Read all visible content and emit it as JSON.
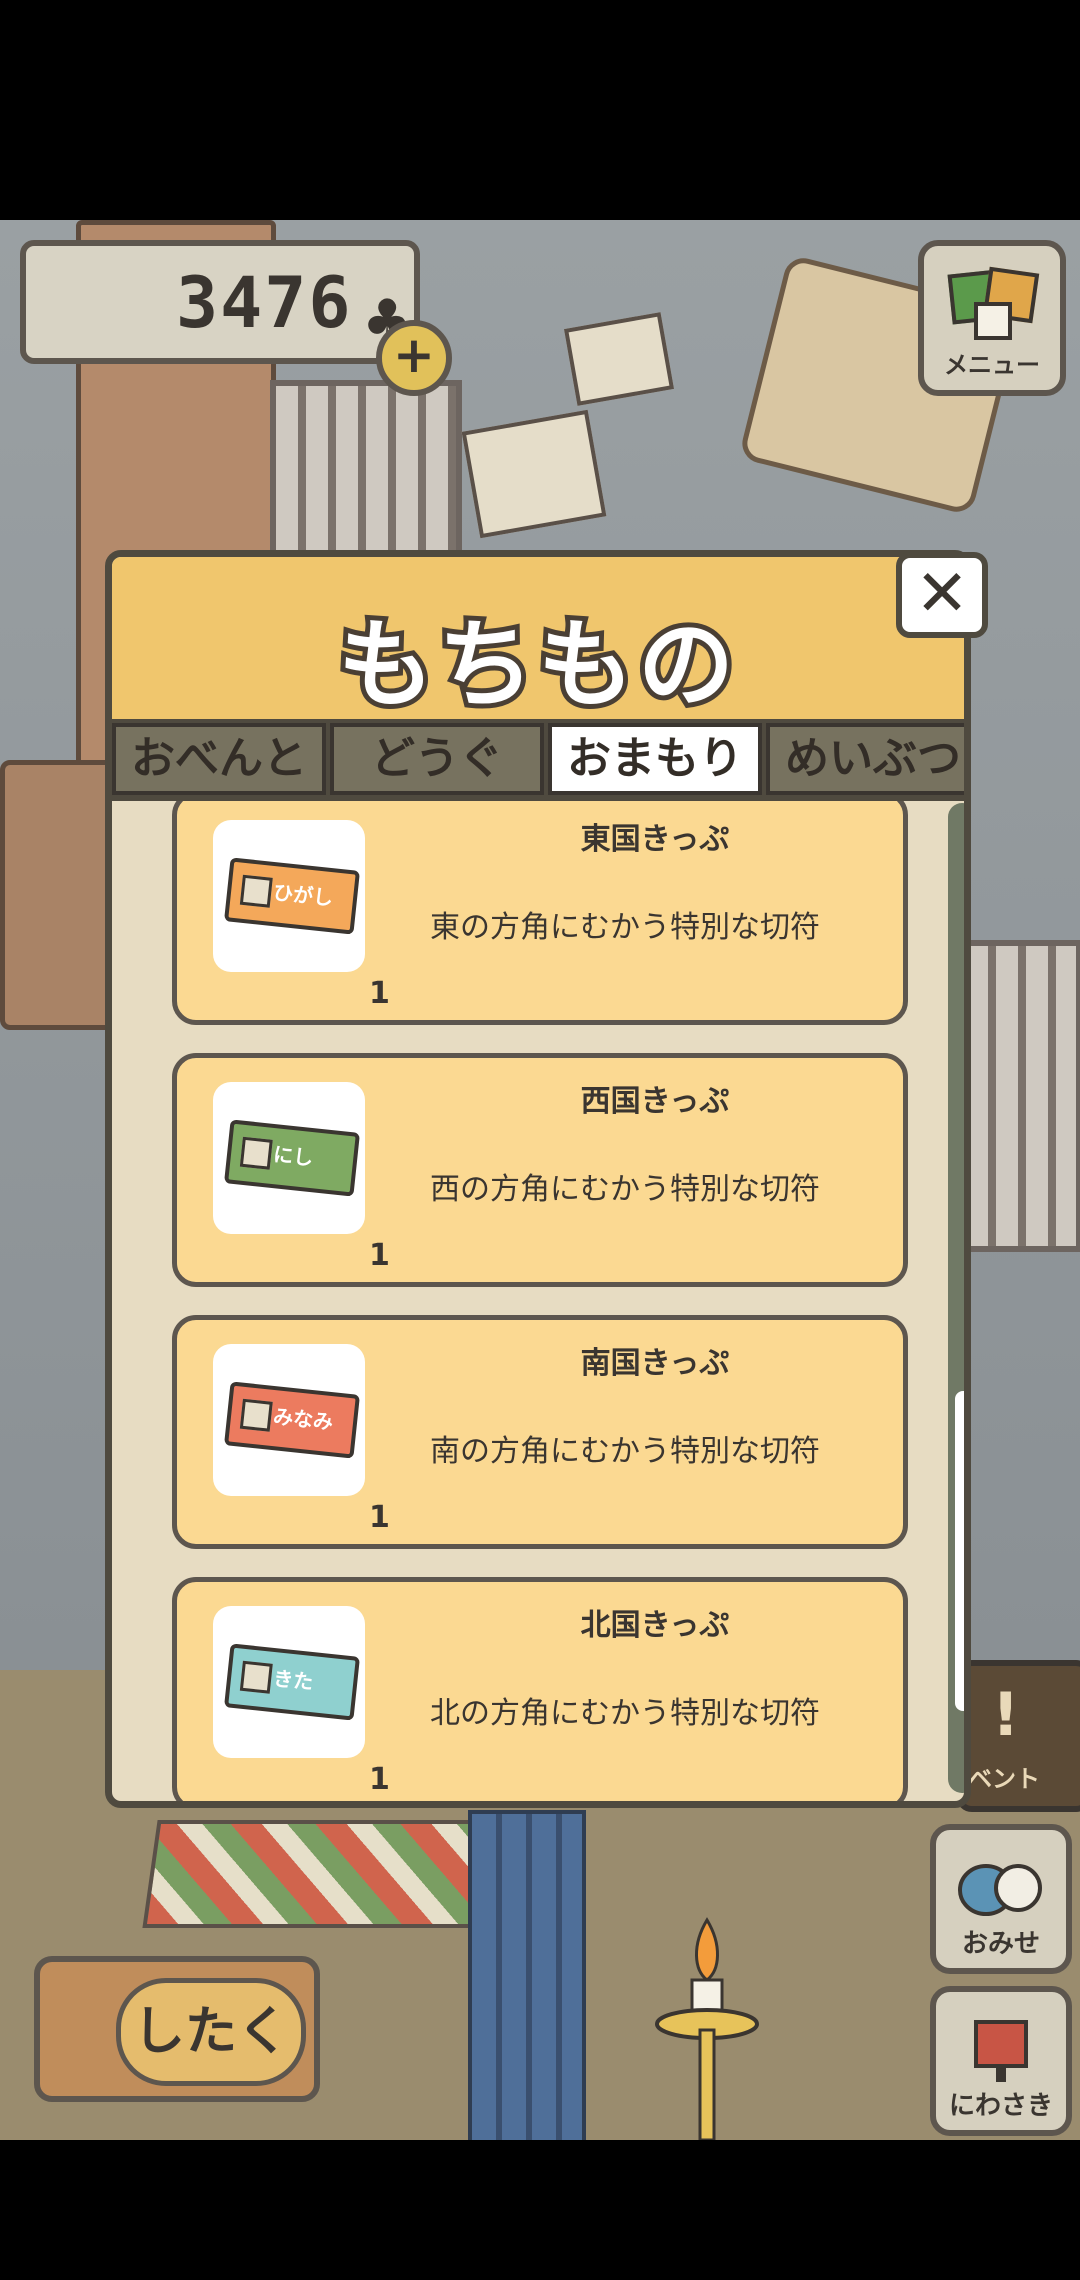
{
  "currency": {
    "amount": "3476",
    "symbol": "♣",
    "add": "+"
  },
  "menu": {
    "label": "メニュー"
  },
  "modal": {
    "title": "もちもの",
    "close": "✕",
    "tabs": [
      {
        "label": "おべんとう",
        "active": false
      },
      {
        "label": "どうぐ",
        "active": false
      },
      {
        "label": "おまもり",
        "active": true
      },
      {
        "label": "めいぶつ",
        "active": false
      }
    ],
    "items": [
      {
        "title": "東国きっぷ",
        "desc": "東の方角にむかう特別な切符",
        "qty": "1",
        "ticket_label": "ひがし",
        "color": "#f4a85a"
      },
      {
        "title": "西国きっぷ",
        "desc": "西の方角にむかう特別な切符",
        "qty": "1",
        "ticket_label": "にし",
        "color": "#7faa62"
      },
      {
        "title": "南国きっぷ",
        "desc": "南の方角にむかう特別な切符",
        "qty": "1",
        "ticket_label": "みなみ",
        "color": "#ec7b5f"
      },
      {
        "title": "北国きっぷ",
        "desc": "北の方角にむかう特別な切符",
        "qty": "1",
        "ticket_label": "きた",
        "color": "#8fd0cf"
      }
    ],
    "scroll_position": 0.62
  },
  "side_buttons": {
    "event": "ベント",
    "event_mark": "!",
    "shop": "おみせ",
    "garden": "にわさき"
  },
  "prepare_button": {
    "label": "したく"
  }
}
